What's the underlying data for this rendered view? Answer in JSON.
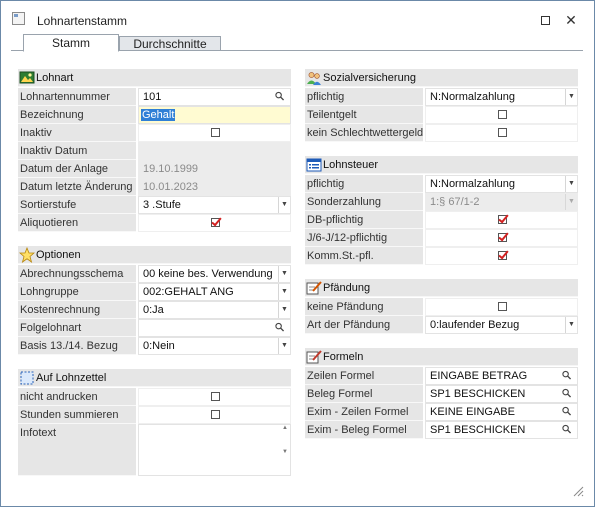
{
  "window": {
    "title": "Lohnartenstamm"
  },
  "tabs": [
    {
      "label": "Stamm"
    },
    {
      "label": "Durchschnitte"
    }
  ],
  "colors": {
    "selection": "#2f7fd6",
    "check": "#d32020",
    "highlight_field": "#fffbd2"
  },
  "left": {
    "lohnart": {
      "title": "Lohnart",
      "icon": "picture-icon",
      "rows": [
        {
          "label": "Lohnartennummer",
          "value": "101"
        },
        {
          "label": "Bezeichnung",
          "value": "Gehalt"
        },
        {
          "label": "Inaktiv",
          "checked": false
        },
        {
          "label": "Inaktiv Datum",
          "value": ""
        },
        {
          "label": "Datum der Anlage",
          "value": "19.10.1999"
        },
        {
          "label": "Datum letzte Änderung",
          "value": "10.01.2023"
        },
        {
          "label": "Sortierstufe",
          "value": "3 .Stufe"
        },
        {
          "label": "Aliquotieren",
          "checked": true
        }
      ]
    },
    "optionen": {
      "title": "Optionen",
      "icon": "star-icon",
      "rows": [
        {
          "label": "Abrechnungsschema",
          "value": "00 keine bes. Verwendung"
        },
        {
          "label": "Lohngruppe",
          "value": "002:GEHALT ANG"
        },
        {
          "label": "Kostenrechnung",
          "value": "0:Ja"
        },
        {
          "label": "Folgelohnart",
          "value": ""
        },
        {
          "label": "Basis 13./14. Bezug",
          "value": "0:Nein"
        }
      ]
    },
    "lohnzettel": {
      "title": "Auf Lohnzettel",
      "icon": "selection-frame-icon",
      "rows": [
        {
          "label": "nicht andrucken",
          "checked": false
        },
        {
          "label": "Stunden summieren",
          "checked": false
        },
        {
          "label": "Infotext",
          "value": ""
        }
      ]
    }
  },
  "right": {
    "sozial": {
      "title": "Sozialversicherung",
      "icon": "people-icon",
      "rows": [
        {
          "label": "pflichtig",
          "value": "N:Normalzahlung"
        },
        {
          "label": "Teilentgelt",
          "checked": false
        },
        {
          "label": "kein Schlechtwettergeld",
          "checked": false
        }
      ]
    },
    "steuer": {
      "title": "Lohnsteuer",
      "icon": "list-icon",
      "rows": [
        {
          "label": "pflichtig",
          "value": "N:Normalzahlung"
        },
        {
          "label": "Sonderzahlung",
          "value": "1:§ 67/1-2"
        },
        {
          "label": "DB-pflichtig",
          "checked": true
        },
        {
          "label": "J/6-J/12-pflichtig",
          "checked": true
        },
        {
          "label": "Komm.St.-pfl.",
          "checked": true
        }
      ]
    },
    "pfaendung": {
      "title": "Pfändung",
      "icon": "note-pencil-icon",
      "rows": [
        {
          "label": "keine Pfändung",
          "checked": false
        },
        {
          "label": "Art der Pfändung",
          "value": "0:laufender Bezug"
        }
      ]
    },
    "formeln": {
      "title": "Formeln",
      "icon": "note-pencil-icon",
      "rows": [
        {
          "label": "Zeilen Formel",
          "value": "EINGABE BETRAG"
        },
        {
          "label": "Beleg Formel",
          "value": "SP1 BESCHICKEN"
        },
        {
          "label": "Exim - Zeilen Formel",
          "value": "KEINE EINGABE"
        },
        {
          "label": "Exim - Beleg Formel",
          "value": "SP1 BESCHICKEN"
        }
      ]
    }
  }
}
